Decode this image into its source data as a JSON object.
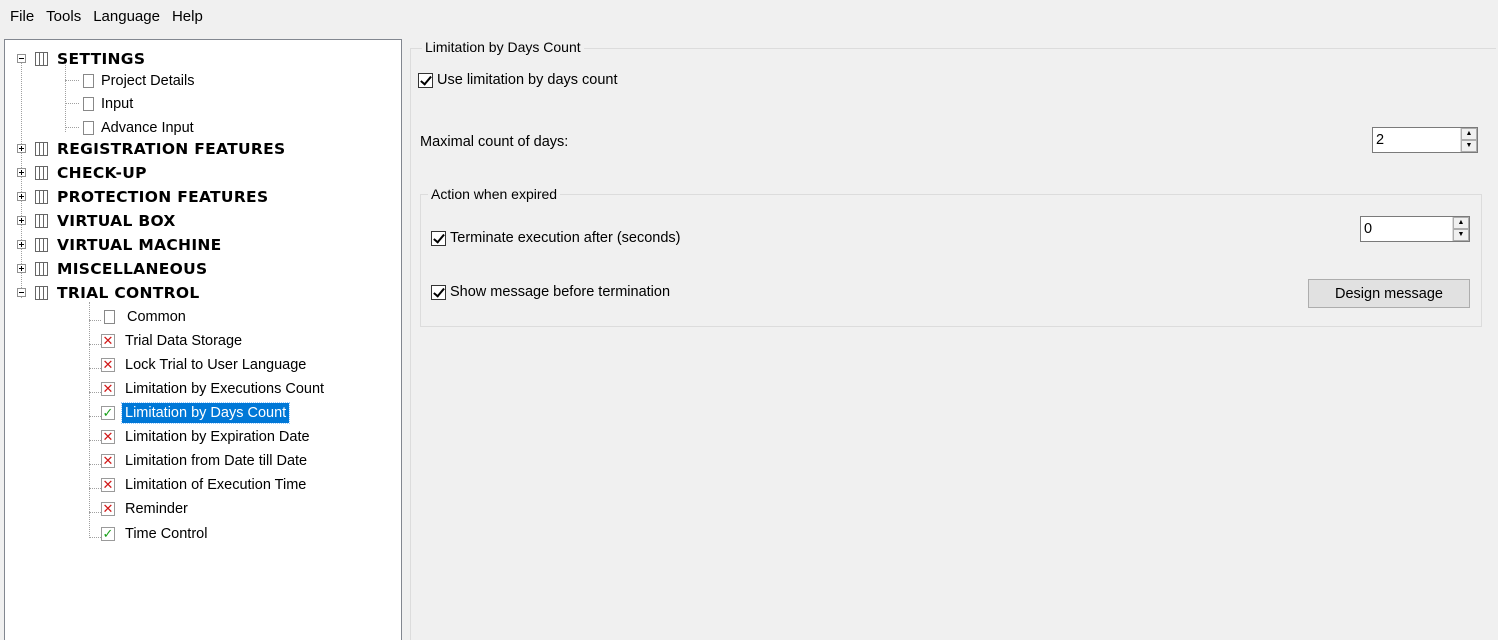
{
  "menu": [
    "File",
    "Tools",
    "Language",
    "Help"
  ],
  "tree": {
    "root": "SETTINGS",
    "settings_children": [
      "Project Details",
      "Input",
      "Advance Input"
    ],
    "sections": [
      "REGISTRATION FEATURES",
      "CHECK-UP",
      "PROTECTION FEATURES",
      "VIRTUAL BOX",
      "VIRTUAL MACHINE",
      "MISCELLANEOUS",
      "TRIAL CONTROL"
    ],
    "trial_children": [
      {
        "label": "Common",
        "status": "page"
      },
      {
        "label": "Trial Data Storage",
        "status": "disabled"
      },
      {
        "label": "Lock Trial to User Language",
        "status": "disabled"
      },
      {
        "label": "Limitation by Executions Count",
        "status": "disabled"
      },
      {
        "label": "Limitation by Days Count",
        "status": "enabled",
        "selected": true
      },
      {
        "label": "Limitation by Expiration Date",
        "status": "disabled"
      },
      {
        "label": "Limitation from Date till Date",
        "status": "disabled"
      },
      {
        "label": "Limitation of Execution Time",
        "status": "disabled"
      },
      {
        "label": "Reminder",
        "status": "disabled"
      },
      {
        "label": "Time Control",
        "status": "enabled"
      }
    ]
  },
  "panel": {
    "group_title": "Limitation by Days Count",
    "use_limitation_label": "Use limitation by days count",
    "use_limitation_checked": true,
    "max_days_label": "Maximal count of days:",
    "max_days_value": "2",
    "action_group_title": "Action when expired",
    "terminate_label": "Terminate execution after (seconds)",
    "terminate_checked": true,
    "terminate_value": "0",
    "show_message_label": "Show message before termination",
    "show_message_checked": true,
    "design_message_button": "Design message"
  },
  "colors": {
    "selection": "#0078d7",
    "check": "#1aa01a",
    "cross": "#d01818",
    "background": "#f0f0f0"
  }
}
